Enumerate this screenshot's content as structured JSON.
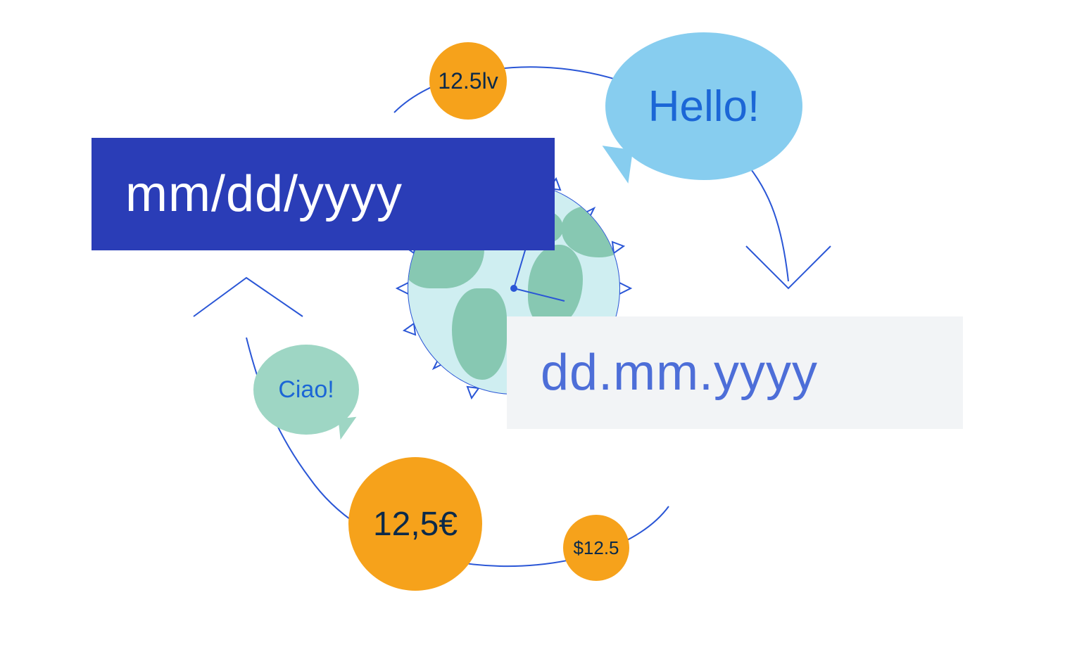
{
  "dateFormats": {
    "us": "mm/dd/yyyy",
    "eu": "dd.mm.yyyy"
  },
  "greetings": {
    "english": "Hello!",
    "italian": "Ciao!"
  },
  "currencies": {
    "bgn": "12.5lv",
    "eur": "12,5€",
    "usd": "$12.5"
  },
  "colors": {
    "accentBlue": "#2a56d6",
    "boxBlue": "#2a3db7",
    "lightBlueBubble": "#87cdef",
    "mintBubble": "#9ed6c4",
    "orange": "#f6a21b",
    "globeOcean": "#cfeef1",
    "globeLand": "#87c8b2",
    "lightGreyBox": "#f2f4f6"
  }
}
